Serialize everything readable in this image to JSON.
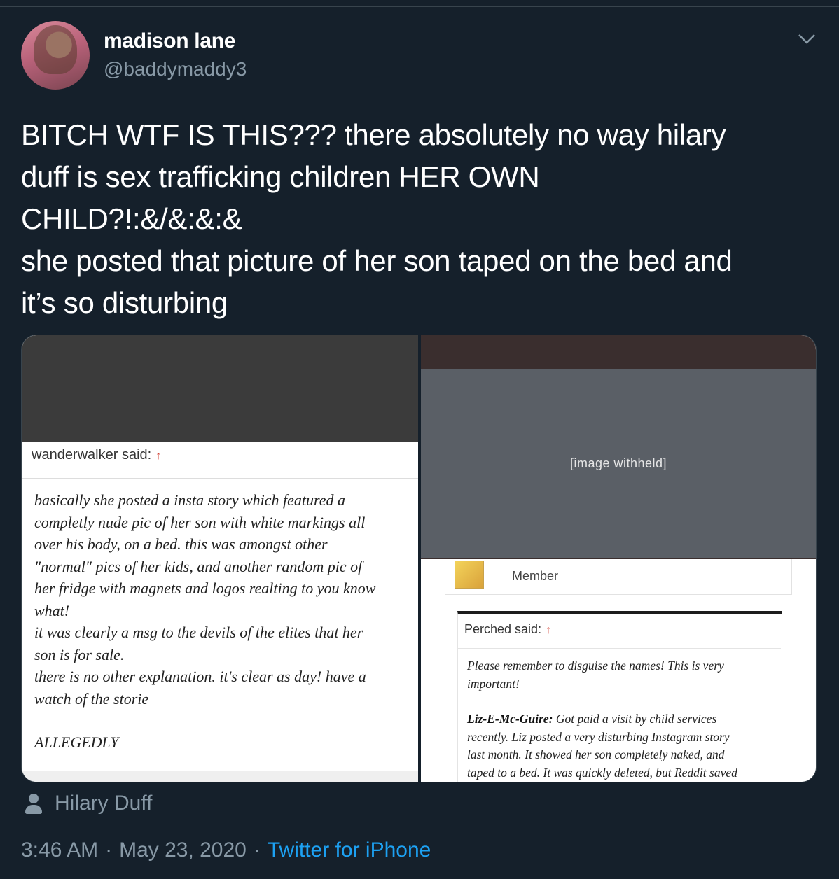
{
  "author": {
    "name": "madison lane",
    "handle": "@baddymaddy3"
  },
  "tweet": {
    "lines": [
      "BITCH WTF IS THIS??? there absolutely no way hilary",
      "duff is sex trafficking children HER OWN",
      "CHILD?!:&/&:&:&",
      "she posted that picture of her son taped on the bed and",
      "it’s so disturbing"
    ]
  },
  "media": {
    "left_panel": {
      "said_label": "wanderwalker said:",
      "lines": [
        "basically she posted a insta story which featured a",
        "completly nude pic of her son with white markings all",
        "over his body, on a bed. this was amongst other",
        "\"normal\" pics of her kids, and another random pic of",
        "her fridge with magnets and logos realting to you know",
        "what!",
        "it was clearly a msg to the devils of the elites that her",
        "son is for sale.",
        "there is no other explanation. it's clear as day! have a",
        "watch of the storie"
      ],
      "closing": "ALLEGEDLY"
    },
    "right_panel": {
      "member_label": "Member",
      "said_label": "Perched said:",
      "notice_lines": [
        "Please remember to disguise the names! This is very",
        "important!"
      ],
      "quote_author": "Liz-E-Mc-Guire:",
      "quote_lines": [
        " Got paid a visit by child services",
        "recently. Liz posted a very disturbing Instagram story",
        "last month. It showed her son completely naked, and",
        "taped to a bed. It was quickly deleted, but Reddit saved"
      ]
    }
  },
  "tagged_person": "Hilary Duff",
  "meta": {
    "time": "3:46 AM",
    "date": "May 23, 2020",
    "source": "Twitter for iPhone"
  },
  "colors": {
    "background": "#15202b",
    "text": "#ffffff",
    "muted": "#8899a6",
    "link": "#1da1f2"
  },
  "icons": [
    "chevron-down-icon",
    "person-icon",
    "arrow-up-icon"
  ]
}
